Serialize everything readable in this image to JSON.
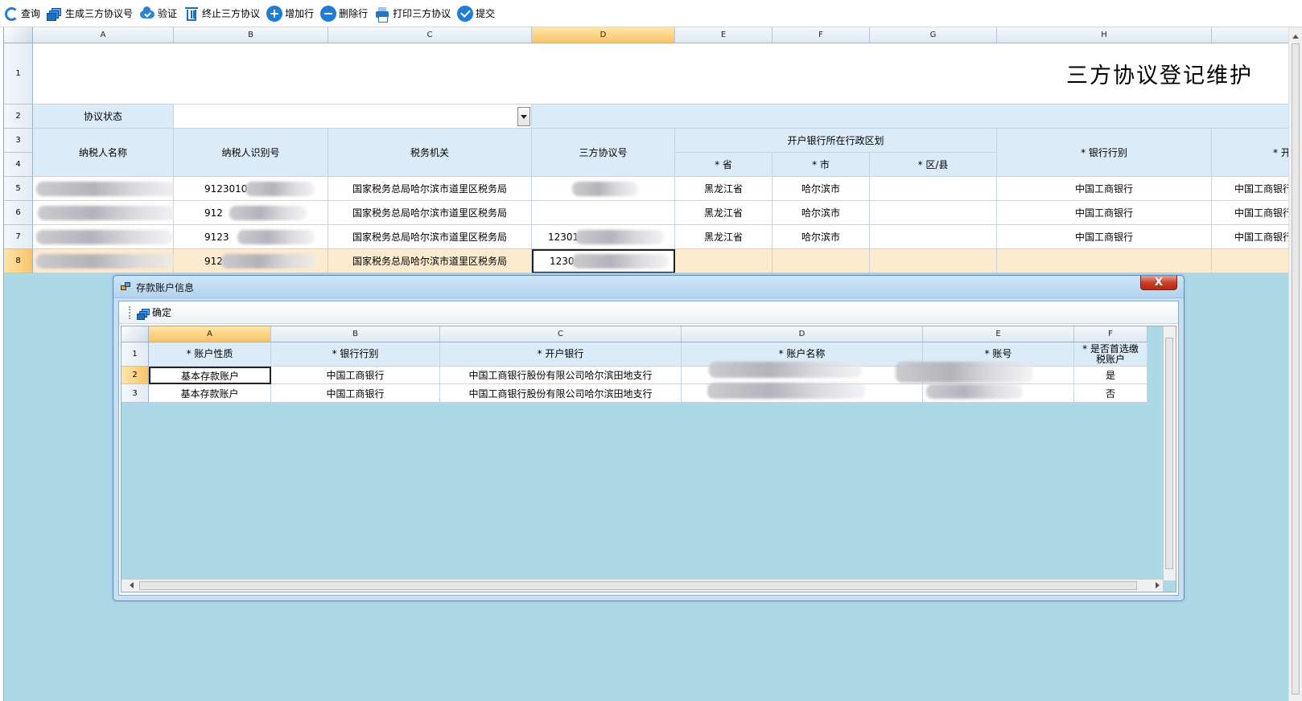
{
  "toolbar": {
    "query": "查询",
    "generate": "生成三方协议号",
    "verify": "验证",
    "terminate": "终止三方协议",
    "add_row": "增加行",
    "delete_row": "删除行",
    "print": "打印三方协议",
    "submit": "提交"
  },
  "sheet": {
    "columns": [
      "A",
      "B",
      "C",
      "D",
      "E",
      "F",
      "G",
      "H"
    ],
    "rows": [
      "1",
      "2",
      "3",
      "4",
      "5",
      "6",
      "7",
      "8"
    ],
    "title": "三方协议登记维护",
    "status_label": "协议状态",
    "status_value": "",
    "headers": {
      "taxpayer_name": "纳税人名称",
      "taxpayer_id": "纳税人识别号",
      "tax_office": "税务机关",
      "agreement_no": "三方协议号",
      "bank_region": "开户银行所在行政区划",
      "province": "* 省",
      "city": "* 市",
      "district": "* 区/县",
      "bank_category": "* 银行行别",
      "next_col_partial": "* 开"
    },
    "data_rows": [
      {
        "id_prefix": "9123010",
        "office": "国家税务总局哈尔滨市道里区税务局",
        "agreement": "",
        "province": "黑龙江省",
        "city": "哈尔滨市",
        "district": "",
        "bank": "中国工商银行",
        "next": "中国工商银行"
      },
      {
        "id_prefix": "912",
        "office": "国家税务总局哈尔滨市道里区税务局",
        "agreement": "",
        "province": "黑龙江省",
        "city": "哈尔滨市",
        "district": "",
        "bank": "中国工商银行",
        "next": "中国工商银行"
      },
      {
        "id_prefix": "9123",
        "office": "国家税务总局哈尔滨市道里区税务局",
        "agreement": "12301",
        "province": "黑龙江省",
        "city": "哈尔滨市",
        "district": "",
        "bank": "中国工商银行",
        "next": "中国工商银行"
      },
      {
        "id_prefix": "912",
        "office": "国家税务总局哈尔滨市道里区税务局",
        "agreement": "1230",
        "province": "",
        "city": "",
        "district": "",
        "bank": "",
        "next": ""
      }
    ]
  },
  "dialog": {
    "title": "存款账户信息",
    "close": "X",
    "confirm": "确定",
    "columns": [
      "A",
      "B",
      "C",
      "D",
      "E",
      "F"
    ],
    "rows": [
      "1",
      "2",
      "3"
    ],
    "headers": [
      "* 账户性质",
      "* 银行行别",
      "* 开户银行",
      "* 账户名称",
      "* 账号",
      "* 是否首选缴",
      "税账户"
    ],
    "data_rows": [
      {
        "type": "基本存款账户",
        "bank": "中国工商银行",
        "branch": "中国工商银行股份有限公司哈尔滨田地支行",
        "name": "",
        "account": "",
        "preferred": "是"
      },
      {
        "type": "基本存款账户",
        "bank": "中国工商银行",
        "branch": "中国工商银行股份有限公司哈尔滨田地支行",
        "name": "",
        "account": "",
        "preferred": "否"
      }
    ]
  }
}
